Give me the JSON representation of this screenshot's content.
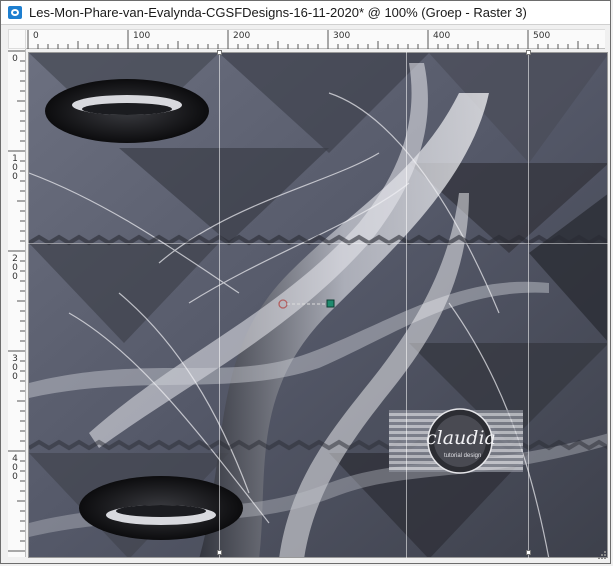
{
  "window": {
    "title": "Les-Mon-Phare-van-Evalynda-CGSFDesigns-16-11-2020* @ 100% (Groep - Raster 3)",
    "app_icon": "camera-icon"
  },
  "rulers": {
    "horizontal_labels": [
      "0",
      "100",
      "200",
      "300",
      "400",
      "500"
    ],
    "vertical_labels": [
      "0",
      "100",
      "200",
      "300",
      "400"
    ]
  },
  "canvas": {
    "background": "#5a5e6e",
    "accent_light": "#e8e8ee",
    "accent_dark": "#1c1d22",
    "watermark": {
      "text": "claudia",
      "subtext": "tutorial design"
    },
    "selection_node_color": "#1f8a6e"
  }
}
